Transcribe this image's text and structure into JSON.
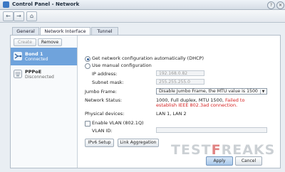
{
  "window": {
    "title": "Control Panel - Network"
  },
  "tabs": [
    {
      "label": "General"
    },
    {
      "label": "Network Interface"
    },
    {
      "label": "Tunnel"
    }
  ],
  "left": {
    "create_label": "Create",
    "remove_label": "Remove",
    "items": [
      {
        "name": "Bond 1",
        "status": "Connected"
      },
      {
        "name": "PPPoE",
        "status": "Disconnected"
      }
    ]
  },
  "form": {
    "dhcp_label": "Get network configuration automatically (DHCP)",
    "manual_label": "Use manual configuration",
    "ip_label": "IP address:",
    "ip_value": "192.168.0.82",
    "subnet_label": "Subnet mask:",
    "subnet_value": "255.255.255.0",
    "jumbo_label": "Jumbo Frame:",
    "jumbo_value": "Disable Jumbo Frame, the MTU value is 1500",
    "status_label": "Network Status:",
    "status_normal": "1000, Full duplex, MTU 1500,",
    "status_error_1": "Failed to",
    "status_error_2": "establish IEEE 802.3ad connection.",
    "physical_label": "Physical devices:",
    "physical_value": "LAN 1, LAN 2",
    "vlan_label": "Enable VLAN (802.1Q)",
    "vlan_id_label": "VLAN ID:",
    "ipv6_button": "IPv6 Setup",
    "link_agg_button": "Link Aggregation"
  },
  "footer": {
    "apply_label": "Apply",
    "cancel_label": "Cancel"
  },
  "watermark": {
    "text_a": "TEST",
    "text_b": "F",
    "text_c": "REAKS"
  },
  "colors": {
    "selected_item": "#6fa3dc",
    "error_text": "#d42020",
    "accent": "#2b5c9a"
  }
}
